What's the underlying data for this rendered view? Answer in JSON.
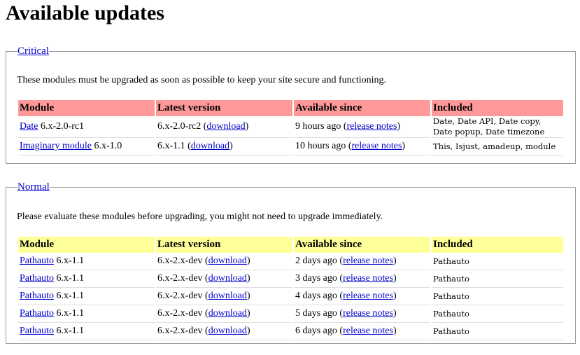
{
  "page_title": "Available updates",
  "critical": {
    "legend": "Critical",
    "intro": "These modules must be upgraded as soon as possible to keep your site secure and functioning.",
    "headers": [
      "Module",
      "Latest version",
      "Available since",
      "Included"
    ],
    "rows": [
      {
        "module": "Date",
        "module_version": "6.x-2.0-rc1",
        "latest": "6.x-2.0-rc2",
        "download": "download",
        "since": "9 hours ago",
        "notes": "release notes",
        "included": "Date, Date API, Date copy, Date popup, Date timezone"
      },
      {
        "module": "Imaginary module",
        "module_version": "6.x-1.0",
        "latest": "6.x-1.1",
        "download": "download",
        "since": "10 hours ago",
        "notes": "release notes",
        "included": "This, Isjust, amadeup, module"
      }
    ]
  },
  "normal": {
    "legend": "Normal",
    "intro": "Please evaluate these modules before upgrading, you might not need to upgrade immediately.",
    "headers": [
      "Module",
      "Latest version",
      "Available since",
      "Included"
    ],
    "rows": [
      {
        "module": "Pathauto",
        "module_version": "6.x-1.1",
        "latest": "6.x-2.x-dev",
        "download": "download",
        "since": "2 days ago",
        "notes": "release notes",
        "included": "Pathauto"
      },
      {
        "module": "Pathauto",
        "module_version": "6.x-1.1",
        "latest": "6.x-2.x-dev",
        "download": "download",
        "since": "3 days ago",
        "notes": "release notes",
        "included": "Pathauto"
      },
      {
        "module": "Pathauto",
        "module_version": "6.x-1.1",
        "latest": "6.x-2.x-dev",
        "download": "download",
        "since": "4 days ago",
        "notes": "release notes",
        "included": "Pathauto"
      },
      {
        "module": "Pathauto",
        "module_version": "6.x-1.1",
        "latest": "6.x-2.x-dev",
        "download": "download",
        "since": "5 days ago",
        "notes": "release notes",
        "included": "Pathauto"
      },
      {
        "module": "Pathauto",
        "module_version": "6.x-1.1",
        "latest": "6.x-2.x-dev",
        "download": "download",
        "since": "6 days ago",
        "notes": "release notes",
        "included": "Pathauto"
      }
    ]
  },
  "colors": {
    "critical_header": "#ff9999",
    "normal_header": "#ffff99",
    "link": "#0000cc"
  }
}
